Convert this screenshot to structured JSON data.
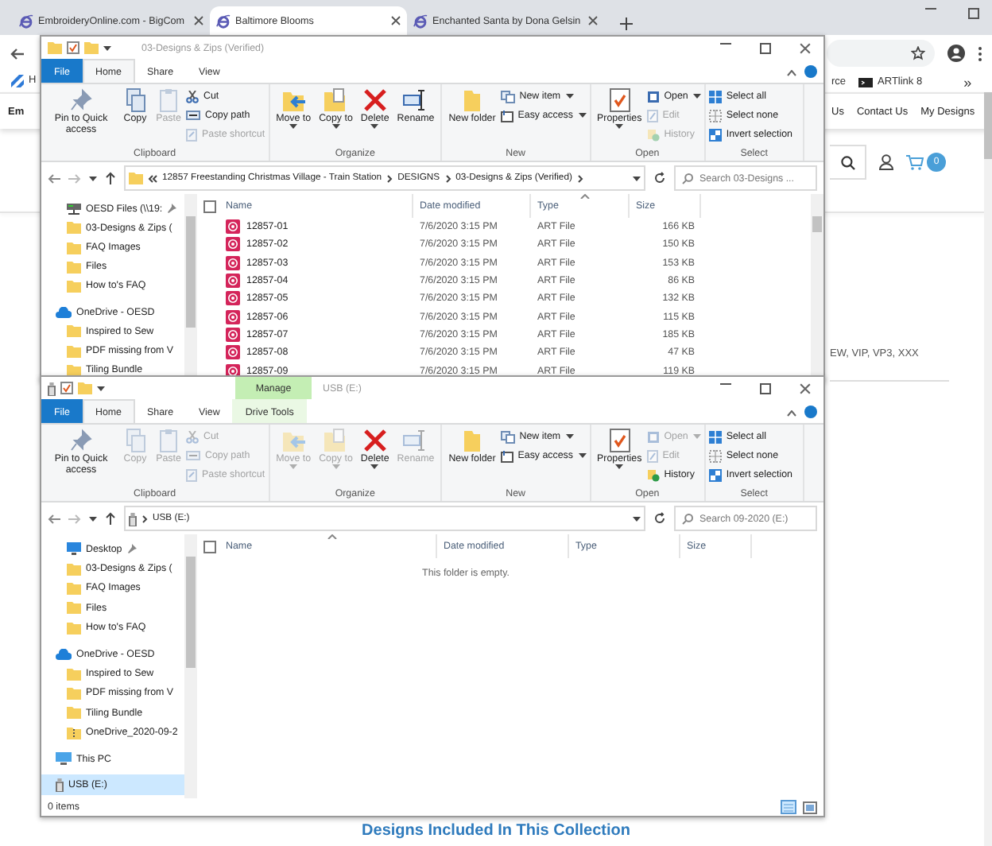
{
  "browser": {
    "tabs": [
      {
        "title": "EmbroideryOnline.com - BigCom",
        "selected": false
      },
      {
        "title": "Baltimore Blooms",
        "selected": true
      },
      {
        "title": "Enchanted Santa by Dona Gelsin",
        "selected": false
      }
    ],
    "bookmarks_left": [
      "H"
    ],
    "bookmarks_right": [
      {
        "label": "rce",
        "kind": "text"
      },
      {
        "label": "ARTlink 8",
        "kind": "app"
      }
    ],
    "bookmarks_more": "»",
    "site_nav_left": "Em",
    "site_nav": [
      "Us",
      "Contact Us",
      "My Designs"
    ],
    "cart_count": "0",
    "formats_text": "EW, VIP, VP3, XXX",
    "section_heading": "Designs Included In This Collection"
  },
  "explorers": [
    {
      "title": "03-Designs & Zips (Verified)",
      "kind": "folder",
      "select_all_checked": false,
      "tabs": [
        {
          "label": "File",
          "kind": "file",
          "selected": false
        },
        {
          "label": "Home",
          "kind": "plain",
          "selected": true
        },
        {
          "label": "Share",
          "kind": "plain",
          "selected": false
        },
        {
          "label": "View",
          "kind": "plain",
          "selected": false
        }
      ],
      "ribbon": [
        {
          "label": "Clipboard",
          "items": [
            {
              "label": "Pin to Quick access",
              "kind": "large",
              "disabled": false,
              "menu": false
            },
            {
              "label": "Copy",
              "kind": "large",
              "disabled": false,
              "menu": false
            },
            {
              "label": "Paste",
              "kind": "large",
              "disabled": true,
              "menu": false
            },
            {
              "label": "Cut",
              "kind": "small",
              "disabled": false,
              "menu": false
            },
            {
              "label": "Copy path",
              "kind": "small",
              "disabled": false,
              "menu": false
            },
            {
              "label": "Paste shortcut",
              "kind": "small",
              "disabled": true,
              "menu": false
            }
          ]
        },
        {
          "label": "Organize",
          "items": [
            {
              "label": "Move to",
              "kind": "large",
              "disabled": false,
              "menu": true
            },
            {
              "label": "Copy to",
              "kind": "large",
              "disabled": false,
              "menu": true
            },
            {
              "label": "Delete",
              "kind": "large",
              "disabled": false,
              "menu": true
            },
            {
              "label": "Rename",
              "kind": "large",
              "disabled": false,
              "menu": false
            }
          ]
        },
        {
          "label": "New",
          "items": [
            {
              "label": "New folder",
              "kind": "large",
              "disabled": false,
              "menu": false
            },
            {
              "label": "New item",
              "kind": "small",
              "disabled": false,
              "menu": true
            },
            {
              "label": "Easy access",
              "kind": "small",
              "disabled": false,
              "menu": true
            }
          ]
        },
        {
          "label": "Open",
          "items": [
            {
              "label": "Properties",
              "kind": "large",
              "disabled": false,
              "menu": true
            },
            {
              "label": "Open",
              "kind": "small",
              "disabled": false,
              "menu": true
            },
            {
              "label": "Edit",
              "kind": "small",
              "disabled": true,
              "menu": false
            },
            {
              "label": "History",
              "kind": "small",
              "disabled": true,
              "menu": false
            }
          ]
        },
        {
          "label": "Select",
          "items": [
            {
              "label": "Select all",
              "kind": "small",
              "disabled": false,
              "menu": false
            },
            {
              "label": "Select none",
              "kind": "small",
              "disabled": false,
              "menu": false
            },
            {
              "label": "Invert selection",
              "kind": "small",
              "disabled": false,
              "menu": false
            }
          ]
        }
      ],
      "address": {
        "overflow": true,
        "crumbs": [
          "12857 Freestanding Christmas Village - Train Station",
          "DESIGNS",
          "03-Designs & Zips (Verified)"
        ]
      },
      "search_placeholder": "Search 03-Designs ...",
      "nav": [
        {
          "label": "OESD Files (\\\\19:",
          "kind": "network",
          "pinned": true,
          "selected": false
        },
        {
          "label": "03-Designs & Zips (",
          "kind": "folder",
          "pinned": false,
          "selected": false
        },
        {
          "label": "FAQ Images",
          "kind": "folder",
          "pinned": false,
          "selected": false
        },
        {
          "label": "Files",
          "kind": "folder",
          "pinned": false,
          "selected": false
        },
        {
          "label": "How to's  FAQ",
          "kind": "folder",
          "pinned": false,
          "selected": false
        },
        {
          "label": "OneDrive - OESD",
          "kind": "cloud",
          "pinned": false,
          "selected": false,
          "children": [
            {
              "label": "Inspired to Sew",
              "kind": "folder",
              "pinned": false,
              "selected": false
            },
            {
              "label": "PDF missing from V",
              "kind": "folder",
              "pinned": false,
              "selected": false
            },
            {
              "label": "Tiling Bundle",
              "kind": "folder",
              "pinned": false,
              "selected": false
            }
          ]
        }
      ],
      "columns": [
        {
          "label": "Name",
          "sorted": false
        },
        {
          "label": "Date modified",
          "sorted": false
        },
        {
          "label": "Type",
          "sorted": true
        },
        {
          "label": "Size",
          "sorted": false
        }
      ],
      "files": [
        {
          "name": "12857-01",
          "date": "7/6/2020 3:15 PM",
          "type": "ART File",
          "size": "166 KB"
        },
        {
          "name": "12857-02",
          "date": "7/6/2020 3:15 PM",
          "type": "ART File",
          "size": "150 KB"
        },
        {
          "name": "12857-03",
          "date": "7/6/2020 3:15 PM",
          "type": "ART File",
          "size": "153 KB"
        },
        {
          "name": "12857-04",
          "date": "7/6/2020 3:15 PM",
          "type": "ART File",
          "size": "86 KB"
        },
        {
          "name": "12857-05",
          "date": "7/6/2020 3:15 PM",
          "type": "ART File",
          "size": "132 KB"
        },
        {
          "name": "12857-06",
          "date": "7/6/2020 3:15 PM",
          "type": "ART File",
          "size": "115 KB"
        },
        {
          "name": "12857-07",
          "date": "7/6/2020 3:15 PM",
          "type": "ART File",
          "size": "185 KB"
        },
        {
          "name": "12857-08",
          "date": "7/6/2020 3:15 PM",
          "type": "ART File",
          "size": "47 KB"
        },
        {
          "name": "12857-09",
          "date": "7/6/2020 3:15 PM",
          "type": "ART File",
          "size": "119 KB"
        }
      ]
    },
    {
      "title": "USB (E:)",
      "kind": "drive",
      "select_all_checked": false,
      "context_label": "Manage",
      "tabs": [
        {
          "label": "File",
          "kind": "file",
          "selected": false
        },
        {
          "label": "Home",
          "kind": "plain",
          "selected": true
        },
        {
          "label": "Share",
          "kind": "plain",
          "selected": false
        },
        {
          "label": "View",
          "kind": "plain",
          "selected": false
        },
        {
          "label": "Drive Tools",
          "kind": "contextual",
          "selected": false
        }
      ],
      "ribbon": [
        {
          "label": "Clipboard",
          "items": [
            {
              "label": "Pin to Quick access",
              "kind": "large",
              "disabled": false,
              "menu": false
            },
            {
              "label": "Copy",
              "kind": "large",
              "disabled": true,
              "menu": false
            },
            {
              "label": "Paste",
              "kind": "large",
              "disabled": true,
              "menu": false
            },
            {
              "label": "Cut",
              "kind": "small",
              "disabled": true,
              "menu": false
            },
            {
              "label": "Copy path",
              "kind": "small",
              "disabled": true,
              "menu": false
            },
            {
              "label": "Paste shortcut",
              "kind": "small",
              "disabled": true,
              "menu": false
            }
          ]
        },
        {
          "label": "Organize",
          "items": [
            {
              "label": "Move to",
              "kind": "large",
              "disabled": true,
              "menu": true
            },
            {
              "label": "Copy to",
              "kind": "large",
              "disabled": true,
              "menu": true
            },
            {
              "label": "Delete",
              "kind": "large",
              "disabled": false,
              "menu": true
            },
            {
              "label": "Rename",
              "kind": "large",
              "disabled": true,
              "menu": false
            }
          ]
        },
        {
          "label": "New",
          "items": [
            {
              "label": "New folder",
              "kind": "large",
              "disabled": false,
              "menu": false
            },
            {
              "label": "New item",
              "kind": "small",
              "disabled": false,
              "menu": true
            },
            {
              "label": "Easy access",
              "kind": "small",
              "disabled": false,
              "menu": true
            }
          ]
        },
        {
          "label": "Open",
          "items": [
            {
              "label": "Properties",
              "kind": "large",
              "disabled": false,
              "menu": true
            },
            {
              "label": "Open",
              "kind": "small",
              "disabled": true,
              "menu": true
            },
            {
              "label": "Edit",
              "kind": "small",
              "disabled": true,
              "menu": false
            },
            {
              "label": "History",
              "kind": "small",
              "disabled": false,
              "menu": false
            }
          ]
        },
        {
          "label": "Select",
          "items": [
            {
              "label": "Select all",
              "kind": "small",
              "disabled": false,
              "menu": false
            },
            {
              "label": "Select none",
              "kind": "small",
              "disabled": false,
              "menu": false
            },
            {
              "label": "Invert selection",
              "kind": "small",
              "disabled": false,
              "menu": false
            }
          ]
        }
      ],
      "address": {
        "overflow": false,
        "crumbs": [
          "USB (E:)"
        ]
      },
      "search_placeholder": "Search 09-2020 (E:)",
      "nav": [
        {
          "label": "Desktop",
          "kind": "desktop",
          "pinned": true,
          "selected": false
        },
        {
          "label": "03-Designs & Zips (",
          "kind": "folder",
          "pinned": false,
          "selected": false
        },
        {
          "label": "FAQ Images",
          "kind": "folder",
          "pinned": false,
          "selected": false
        },
        {
          "label": "Files",
          "kind": "folder",
          "pinned": false,
          "selected": false
        },
        {
          "label": "How to's  FAQ",
          "kind": "folder",
          "pinned": false,
          "selected": false
        },
        {
          "label": "OneDrive - OESD",
          "kind": "cloud",
          "pinned": false,
          "selected": false,
          "children": [
            {
              "label": "Inspired to Sew",
              "kind": "folder",
              "pinned": false,
              "selected": false
            },
            {
              "label": "PDF missing from V",
              "kind": "folder",
              "pinned": false,
              "selected": false
            },
            {
              "label": "Tiling Bundle",
              "kind": "folder",
              "pinned": false,
              "selected": false
            },
            {
              "label": "OneDrive_2020-09-2",
              "kind": "zip",
              "pinned": false,
              "selected": false
            }
          ]
        },
        {
          "label": "This PC",
          "kind": "pc",
          "pinned": false,
          "selected": false
        },
        {
          "label": "USB (E:)",
          "kind": "usb",
          "pinned": false,
          "selected": true
        }
      ],
      "columns": [
        {
          "label": "Name",
          "sorted": true
        },
        {
          "label": "Date modified",
          "sorted": false
        },
        {
          "label": "Type",
          "sorted": false
        },
        {
          "label": "Size",
          "sorted": false
        }
      ],
      "empty_message": "This folder is empty.",
      "status": "0 items"
    }
  ]
}
